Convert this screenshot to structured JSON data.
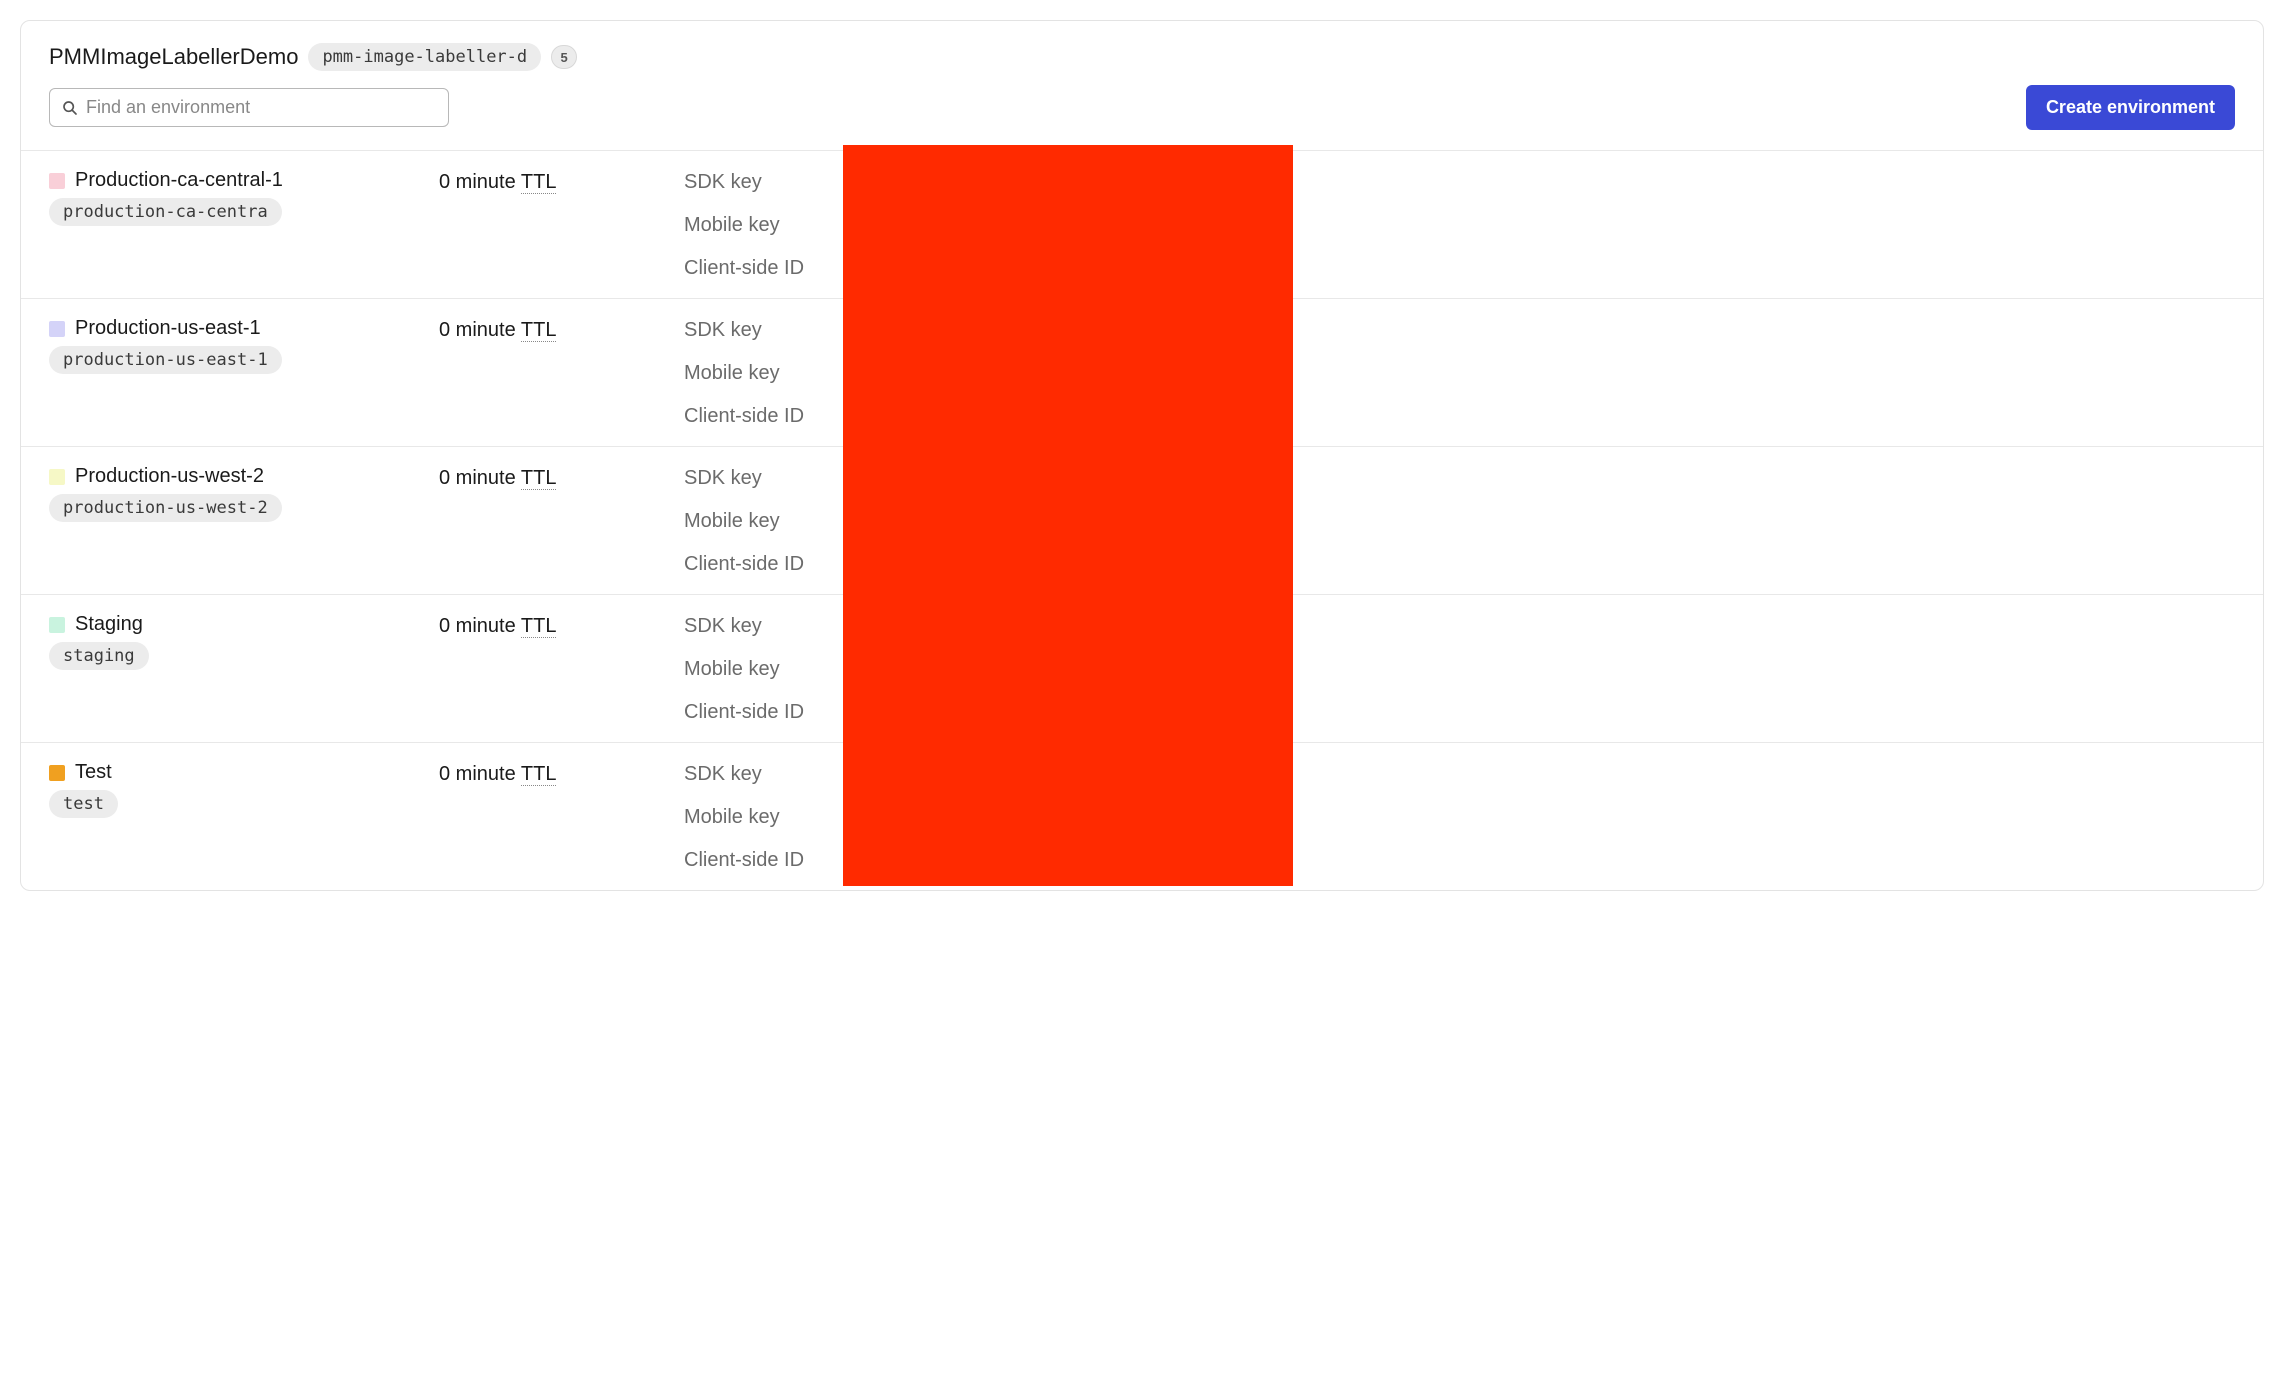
{
  "header": {
    "project_title": "PMMImageLabellerDemo",
    "project_slug": "pmm-image-labeller-d",
    "env_count": "5",
    "search_placeholder": "Find an environment",
    "create_label": "Create environment"
  },
  "ttl_prefix": "0 minute ",
  "ttl_abbr": "TTL",
  "key_labels": {
    "sdk": "SDK key",
    "mobile": "Mobile key",
    "client": "Client-side ID"
  },
  "environments": [
    {
      "name": "Production-ca-central-1",
      "slug": "production-ca-centra",
      "color": "#f9cfd8"
    },
    {
      "name": "Production-us-east-1",
      "slug": "production-us-east-1",
      "color": "#d4d3f8"
    },
    {
      "name": "Production-us-west-2",
      "slug": "production-us-west-2",
      "color": "#f6f8c6"
    },
    {
      "name": "Staging",
      "slug": "staging",
      "color": "#c9f3df"
    },
    {
      "name": "Test",
      "slug": "test",
      "color": "#f0a020"
    }
  ]
}
